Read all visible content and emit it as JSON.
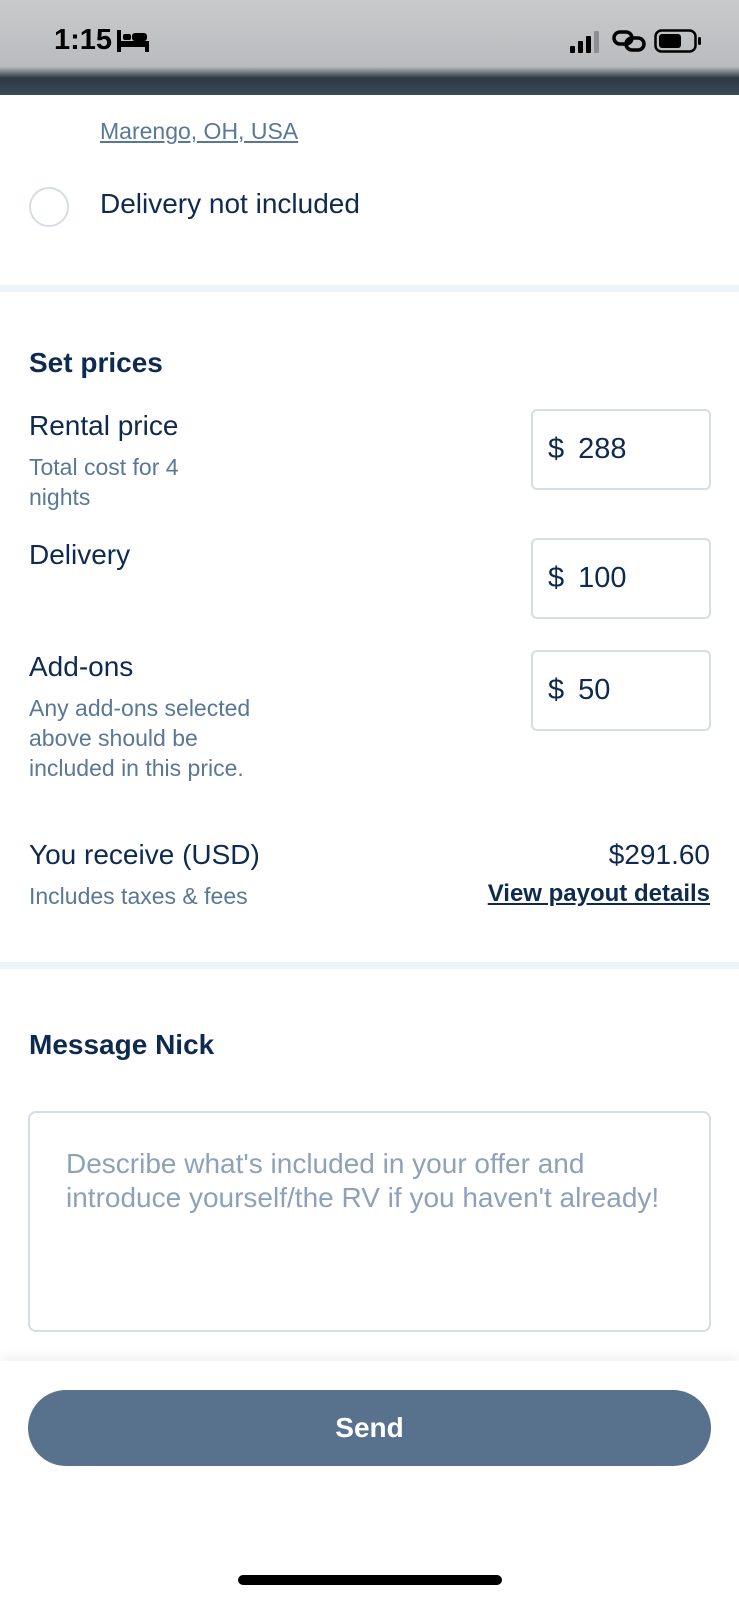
{
  "status_bar": {
    "time": "1:15"
  },
  "delivery": {
    "location_link": "Marengo, OH, USA",
    "option_label": "Delivery not included"
  },
  "prices": {
    "section_title": "Set prices",
    "currency_symbol": "$",
    "rental": {
      "label": "Rental price",
      "sub": "Total cost for 4 nights",
      "value": "288"
    },
    "delivery": {
      "label": "Delivery",
      "value": "100"
    },
    "addons": {
      "label": "Add-ons",
      "sub": "Any add-ons selected above should be included in this price.",
      "value": "50"
    },
    "receive": {
      "label": "You receive (USD)",
      "sub": "Includes taxes & fees",
      "amount": "$291.60",
      "link": "View payout details"
    }
  },
  "message": {
    "title": "Message Nick",
    "placeholder": "Describe what's included in your offer and introduce yourself/the RV if you haven't already!"
  },
  "footer": {
    "send_label": "Send"
  },
  "colors": {
    "accent": "#58728d",
    "text": "#0f2a4f",
    "muted": "#5a7896"
  }
}
